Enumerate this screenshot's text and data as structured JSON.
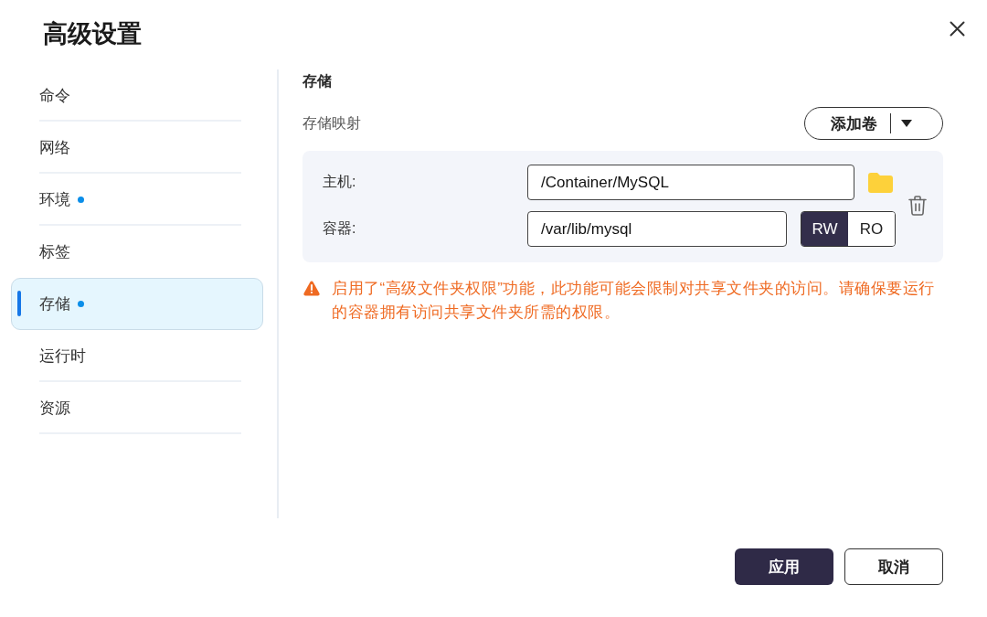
{
  "dialog": {
    "title": "高级设置"
  },
  "sidebar": {
    "items": [
      {
        "label": "命令",
        "selected": false,
        "modified": false
      },
      {
        "label": "网络",
        "selected": false,
        "modified": false
      },
      {
        "label": "环境",
        "selected": false,
        "modified": true
      },
      {
        "label": "标签",
        "selected": false,
        "modified": false
      },
      {
        "label": "存储",
        "selected": true,
        "modified": true
      },
      {
        "label": "运行时",
        "selected": false,
        "modified": false
      },
      {
        "label": "资源",
        "selected": false,
        "modified": false
      }
    ]
  },
  "section": {
    "title": "存储",
    "subtitle": "存储映射",
    "add_button": {
      "label": "添加卷"
    }
  },
  "mappings": [
    {
      "host": {
        "label": "主机:",
        "value": "/Container/MySQL"
      },
      "container": {
        "label": "容器:",
        "value": "/var/lib/mysql"
      },
      "modes": [
        {
          "label": "RW",
          "selected": true
        },
        {
          "label": "RO",
          "selected": false
        }
      ]
    }
  ],
  "warning": "启用了“高级文件夹权限”功能，此功能可能会限制对共享文件夹的访问。请确保要运行的容器拥有访问共享文件夹所需的权限。",
  "buttons": [
    {
      "label": "应用",
      "kind": "primary"
    },
    {
      "label": "取消",
      "kind": "secondary"
    }
  ]
}
